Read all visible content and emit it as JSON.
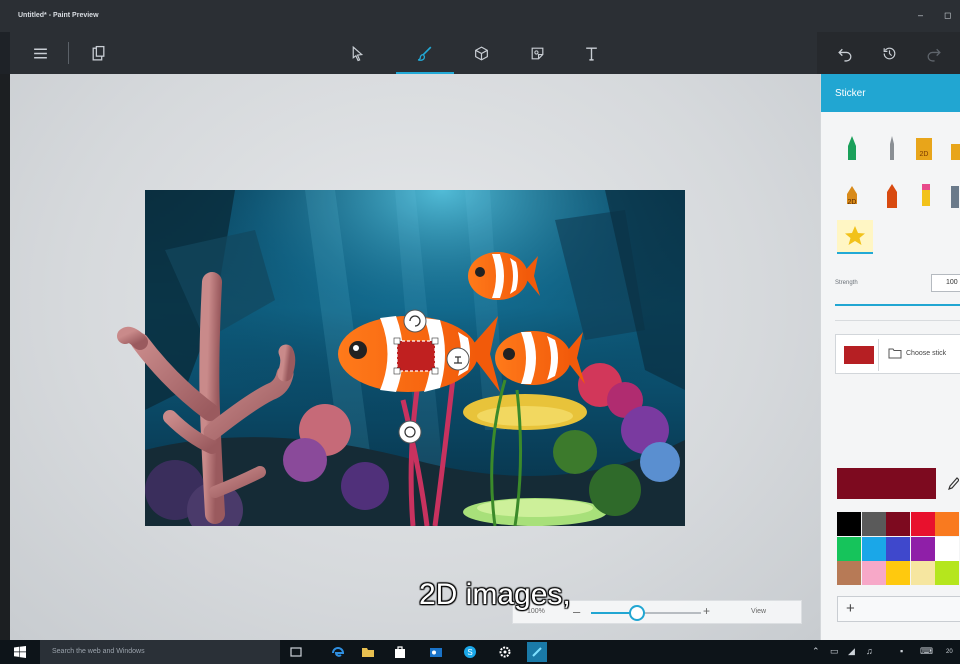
{
  "window": {
    "title": "Untitled* - Paint Preview",
    "minimize_glyph": "–",
    "maximize_glyph": "◻"
  },
  "toolbar": {
    "icons": [
      "menu-icon",
      "paste-icon",
      "select-icon",
      "brush-icon",
      "3d-cube-icon",
      "sticker-icon",
      "text-icon",
      "undo-icon",
      "history-icon",
      "redo-icon"
    ],
    "active": "brush-icon",
    "accent": "#22a9d6"
  },
  "sidebar": {
    "header": "Sticker",
    "header_color": "#21a6d2",
    "strength_label": "Strength",
    "strength_value": "100",
    "choose_label": "Choose stick",
    "current_color": "#7d0a1f",
    "palette": [
      "#000000",
      "#5a5a5a",
      "#7d0a1f",
      "#e8112d",
      "#f97a1f",
      "#16c45b",
      "#1aa7e8",
      "#3f48cc",
      "#8f1fa8",
      "#ffffff",
      "#b77a56",
      "#f7a8c8",
      "#ffc90e",
      "#f6e6a0",
      "#b5e61d"
    ],
    "add_color_label": "+"
  },
  "zoom": {
    "percent": "100%",
    "minus": "–",
    "plus": "+",
    "view_label": "View",
    "level": 0.42
  },
  "subtitle": "2D images,",
  "taskbar": {
    "search_placeholder": "Search the web and Windows",
    "apps": [
      "task-view-icon",
      "edge-icon",
      "file-explorer-icon",
      "store-icon",
      "outlook-icon",
      "skype-icon",
      "settings-icon",
      "paint3d-icon"
    ],
    "clock": "20"
  }
}
